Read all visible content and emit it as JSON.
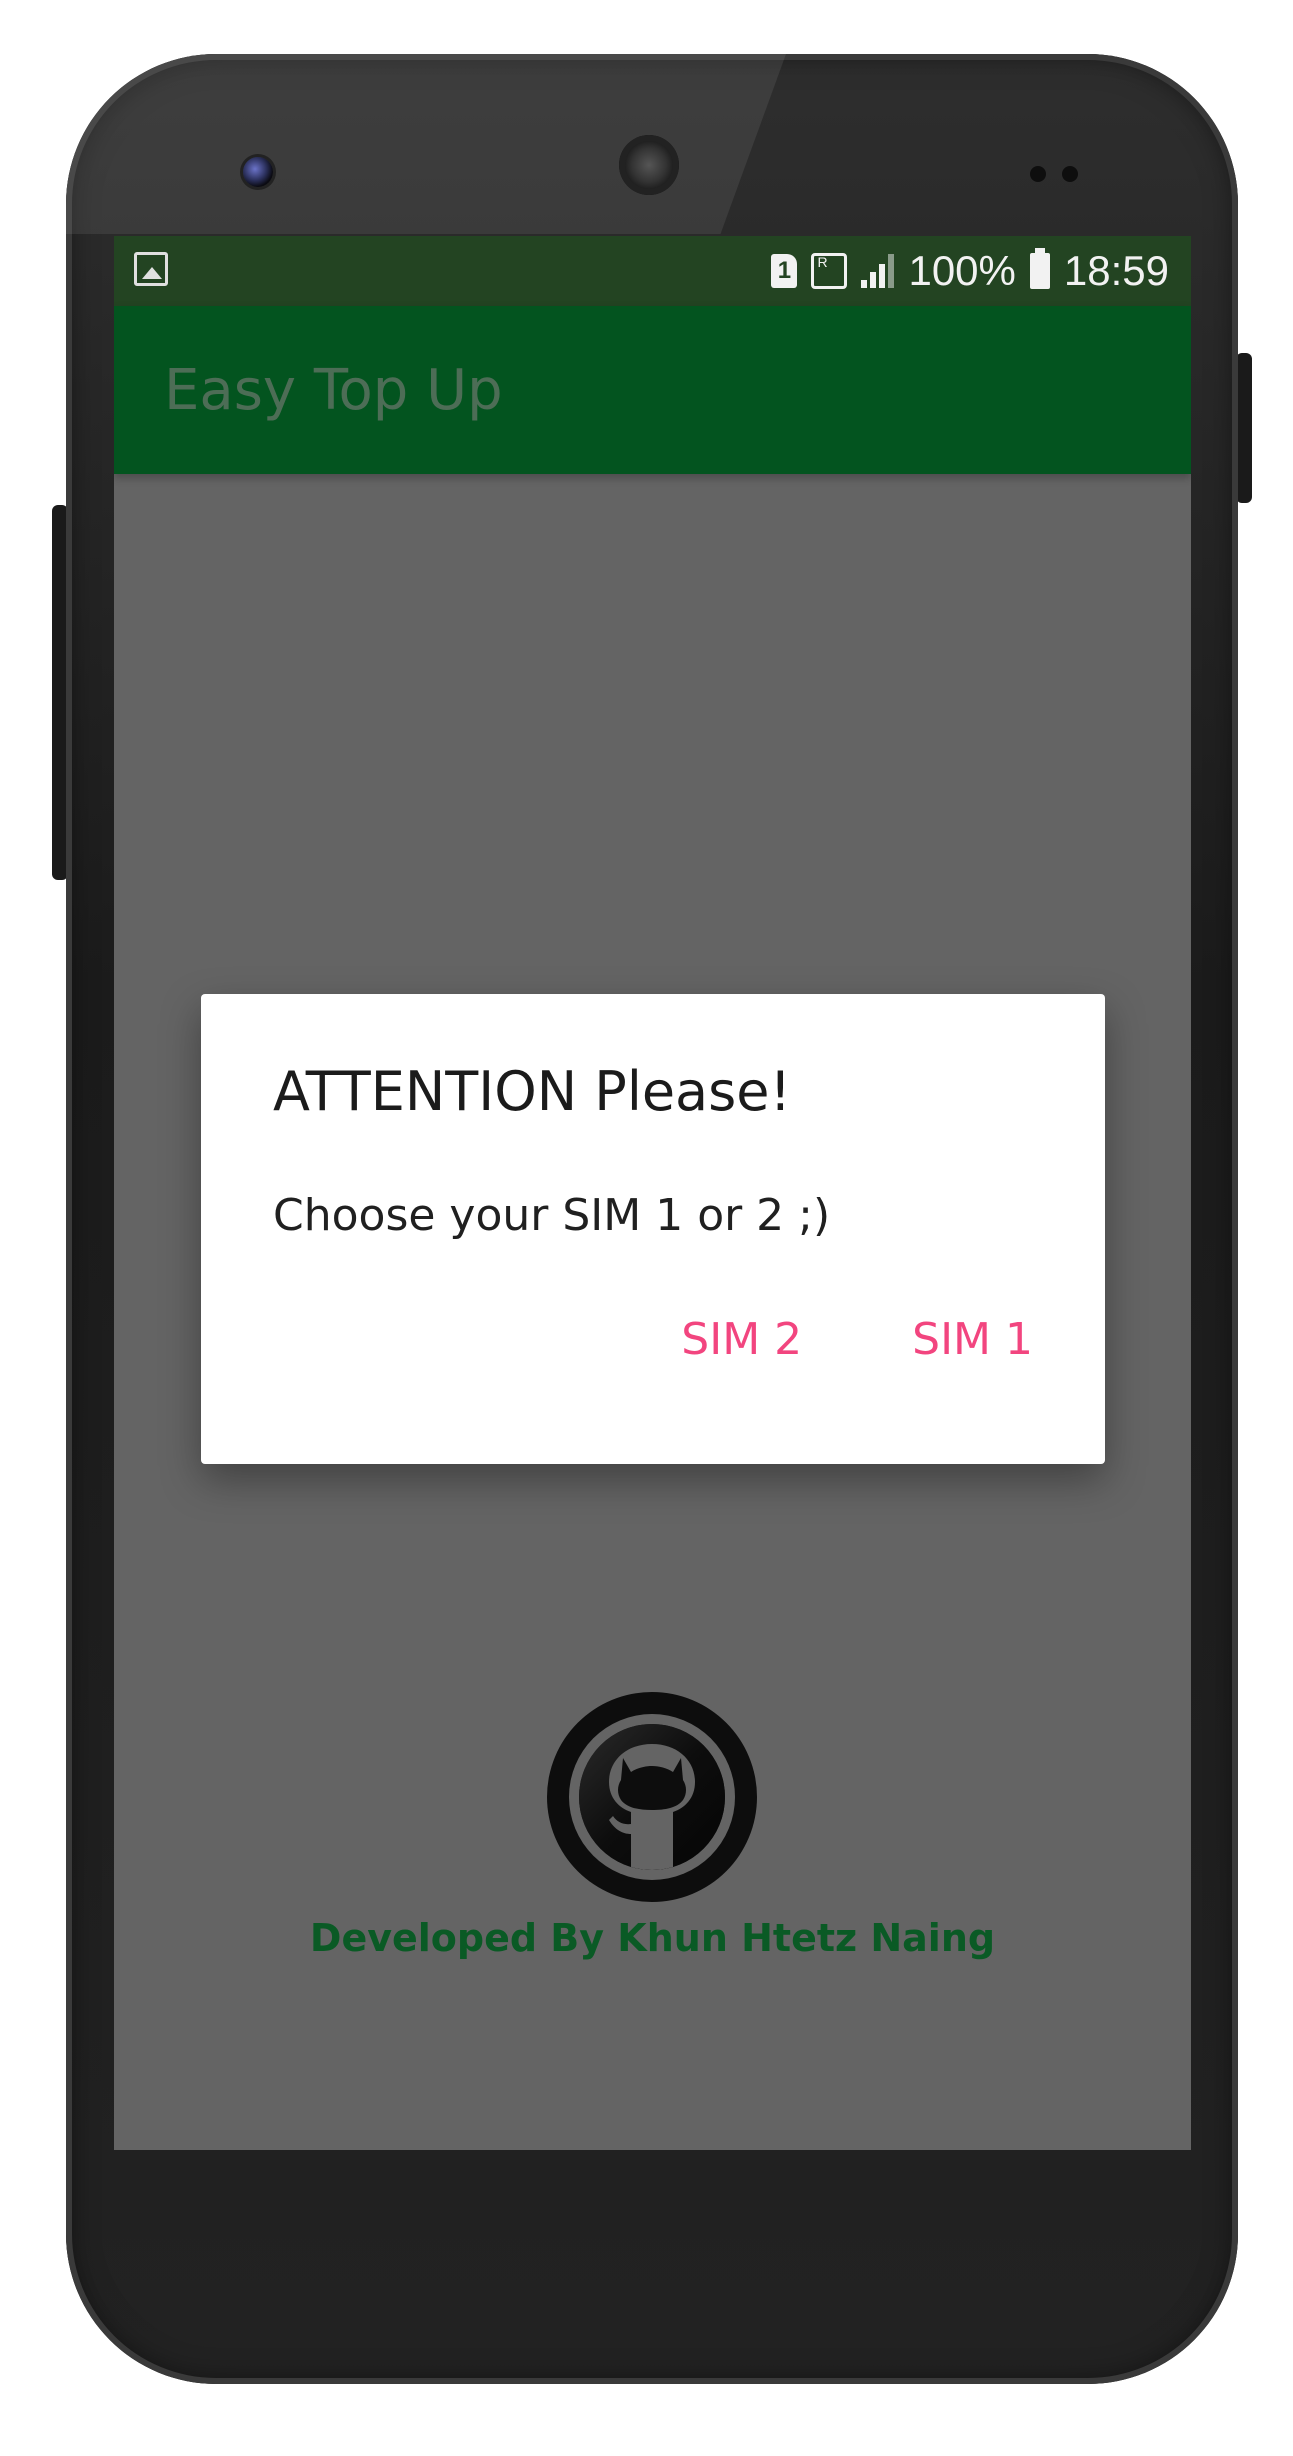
{
  "status_bar": {
    "sim_slot": "1",
    "roaming": "R",
    "battery_percent": "100%",
    "time": "18:59"
  },
  "app_bar": {
    "title": "Easy Top Up"
  },
  "dialog": {
    "title": "ATTENTION Please!",
    "message": "Choose your SIM 1 or 2 ;)",
    "buttons": {
      "sim2": "SIM 2",
      "sim1": "SIM 1"
    }
  },
  "footer": {
    "credit": "Developed By Khun Htetz Naing"
  },
  "colors": {
    "status_bar": "#234422",
    "app_bar": "#03541f",
    "scrim": "#646464",
    "accent": "#f2457f",
    "credit": "#0a5a25"
  }
}
